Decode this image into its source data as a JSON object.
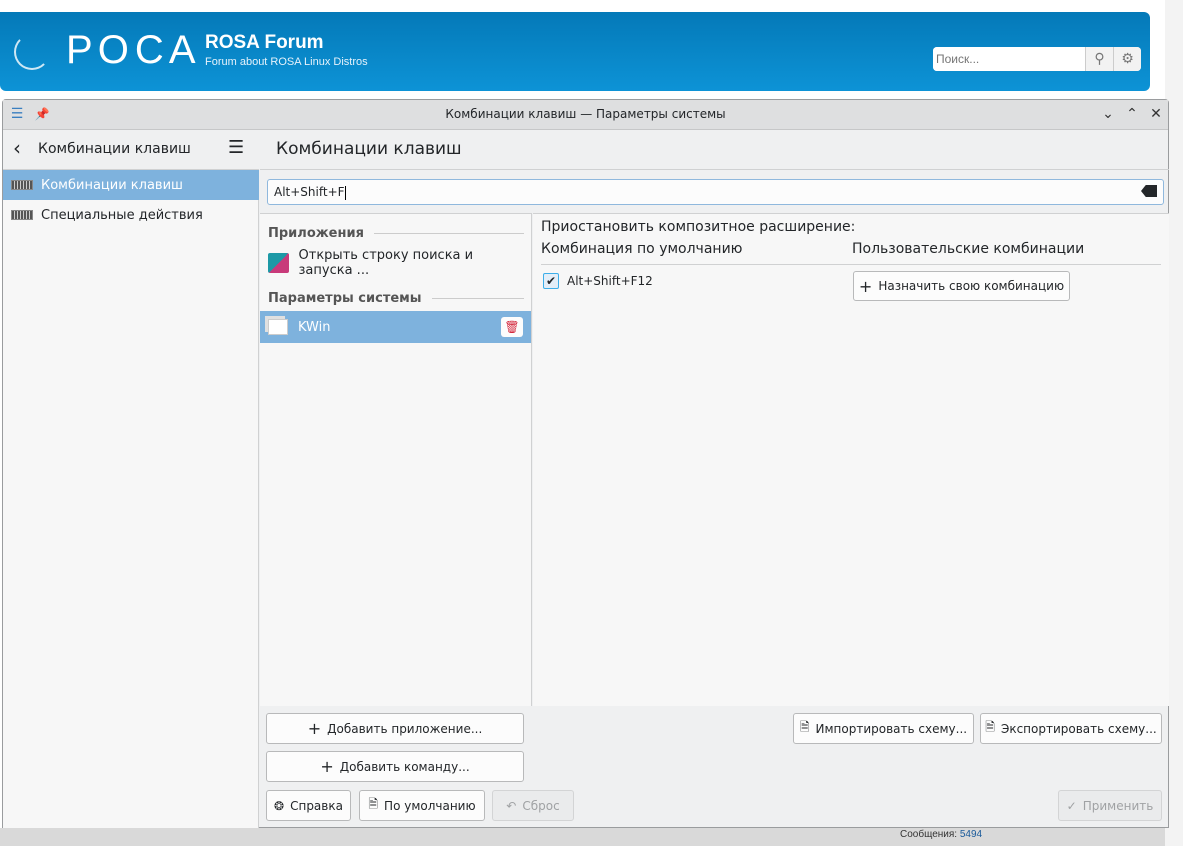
{
  "forum": {
    "logo": "РОСА",
    "title": "ROSA Forum",
    "subtitle": "Forum about ROSA Linux Distros",
    "search_placeholder": "Поиск...",
    "messages_label": "Сообщения:",
    "messages_count": "5494"
  },
  "window": {
    "title": "Комбинации клавиш — Параметры системы"
  },
  "sidebar": {
    "header": "Комбинации клавиш",
    "items": [
      {
        "label": "Комбинации клавиш",
        "selected": true
      },
      {
        "label": "Специальные действия",
        "selected": false
      }
    ]
  },
  "main": {
    "title": "Комбинации клавиш",
    "search_value": "Alt+Shift+F",
    "groups": [
      {
        "label": "Приложения",
        "items": [
          {
            "label": "Открыть строку поиска и запуска ..."
          }
        ]
      },
      {
        "label": "Параметры системы",
        "items": [
          {
            "label": "KWin",
            "selected": true
          }
        ]
      }
    ],
    "detail": {
      "action": "Приостановить композитное расширение:",
      "default_header": "Комбинация по умолчанию",
      "custom_header": "Пользовательские комбинации",
      "default_shortcut": "Alt+Shift+F12",
      "default_checked": true,
      "assign_button": "Назначить свою комбинацию"
    }
  },
  "buttons": {
    "add_app": "Добавить приложение...",
    "add_command": "Добавить команду...",
    "import": "Импортировать схему...",
    "export": "Экспортировать схему...",
    "help": "Справка",
    "defaults": "По умолчанию",
    "reset": "Сброс",
    "apply": "Применить"
  }
}
